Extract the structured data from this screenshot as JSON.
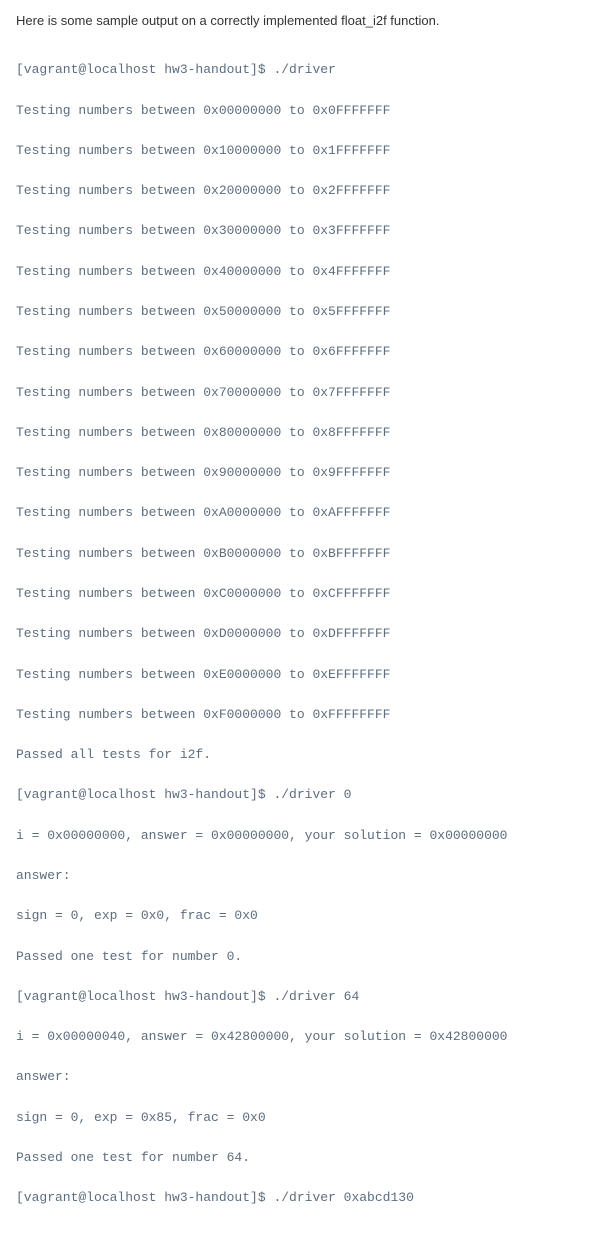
{
  "intro": "Here is some sample output on a correctly implemented float_i2f function.",
  "lines": [
    "[vagrant@localhost hw3-handout]$ ./driver",
    "Testing numbers between 0x00000000 to 0x0FFFFFFF",
    "Testing numbers between 0x10000000 to 0x1FFFFFFF",
    "Testing numbers between 0x20000000 to 0x2FFFFFFF",
    "Testing numbers between 0x30000000 to 0x3FFFFFFF",
    "Testing numbers between 0x40000000 to 0x4FFFFFFF",
    "Testing numbers between 0x50000000 to 0x5FFFFFFF",
    "Testing numbers between 0x60000000 to 0x6FFFFFFF",
    "Testing numbers between 0x70000000 to 0x7FFFFFFF",
    "Testing numbers between 0x80000000 to 0x8FFFFFFF",
    "Testing numbers between 0x90000000 to 0x9FFFFFFF",
    "Testing numbers between 0xA0000000 to 0xAFFFFFFF",
    "Testing numbers between 0xB0000000 to 0xBFFFFFFF",
    "Testing numbers between 0xC0000000 to 0xCFFFFFFF",
    "Testing numbers between 0xD0000000 to 0xDFFFFFFF",
    "Testing numbers between 0xE0000000 to 0xEFFFFFFF",
    "Testing numbers between 0xF0000000 to 0xFFFFFFFF",
    "Passed all tests for i2f.",
    "[vagrant@localhost hw3-handout]$ ./driver 0",
    "i = 0x00000000, answer = 0x00000000, your solution = 0x00000000",
    "answer:",
    "sign = 0, exp = 0x0, frac = 0x0",
    "Passed one test for number 0.",
    "[vagrant@localhost hw3-handout]$ ./driver 64",
    "i = 0x00000040, answer = 0x42800000, your solution = 0x42800000",
    "answer:",
    "sign = 0, exp = 0x85, frac = 0x0",
    "Passed one test for number 64.",
    "[vagrant@localhost hw3-handout]$ ./driver 0xabcd130"
  ]
}
